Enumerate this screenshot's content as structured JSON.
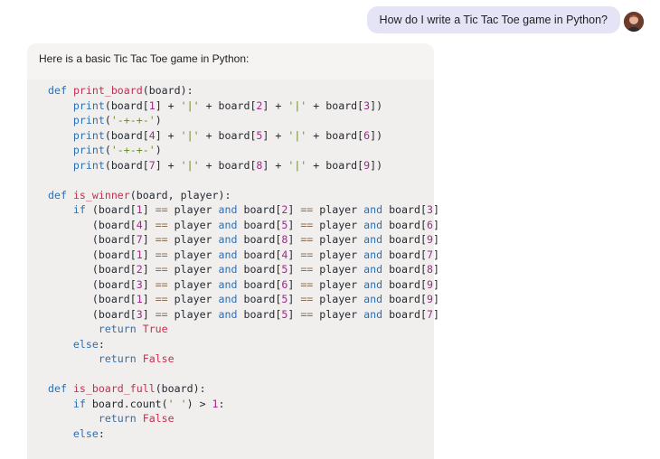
{
  "conversation": {
    "user_message": "How do I write a Tic Tac Toe game in Python?",
    "assistant_intro": "Here is a basic Tic Tac Toe game in Python:"
  },
  "code": {
    "language": "python",
    "lines": [
      "def print_board(board):",
      "    print(board[1] + '|' + board[2] + '|' + board[3])",
      "    print('-+-+-')",
      "    print(board[4] + '|' + board[5] + '|' + board[6])",
      "    print('-+-+-')",
      "    print(board[7] + '|' + board[8] + '|' + board[9])",
      "",
      "def is_winner(board, player):",
      "    if (board[1] == player and board[2] == player and board[3]",
      "       (board[4] == player and board[5] == player and board[6]",
      "       (board[7] == player and board[8] == player and board[9]",
      "       (board[1] == player and board[4] == player and board[7]",
      "       (board[2] == player and board[5] == player and board[8]",
      "       (board[3] == player and board[6] == player and board[9]",
      "       (board[1] == player and board[5] == player and board[9]",
      "       (board[3] == player and board[5] == player and board[7]",
      "        return True",
      "    else:",
      "        return False",
      "",
      "def is_board_full(board):",
      "    if board.count(' ') > 1:",
      "        return False",
      "    else:"
    ]
  },
  "colors": {
    "user_bubble": "#e5e4f7",
    "assistant_panel": "#f5f4f3",
    "code_background": "#f1efee",
    "keyword": "#2b6fb3",
    "function_name": "#c2304f",
    "string": "#6e8c2a",
    "number": "#9b2a8a"
  },
  "icons": {
    "avatar": "user-avatar-photo"
  }
}
